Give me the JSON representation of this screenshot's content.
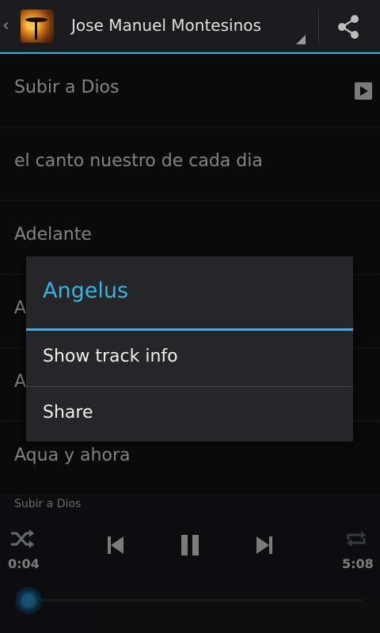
{
  "action_bar": {
    "title": "Jose Manuel Montesinos",
    "back_glyph": "‹"
  },
  "tracks": [
    {
      "label": "Subir a Dios"
    },
    {
      "label": "el canto nuestro de cada dia"
    },
    {
      "label": "Adelante"
    },
    {
      "label": "A"
    },
    {
      "label": "A"
    },
    {
      "label": "Aqua y ahora"
    }
  ],
  "dialog": {
    "title": "Angelus",
    "items": [
      {
        "label": "Show track info"
      },
      {
        "label": "Share"
      }
    ]
  },
  "player": {
    "now_playing": "Subir a Dios",
    "elapsed": "0:04",
    "duration": "5:08",
    "progress": 0.013
  },
  "colors": {
    "accent": "#33b5e5",
    "background": "#101012"
  }
}
